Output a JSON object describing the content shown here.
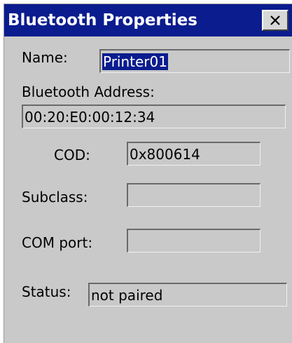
{
  "window": {
    "title": "Bluetooth Properties"
  },
  "icons": {
    "close": "close-icon"
  },
  "colors": {
    "titlebar": "#0b1c8e",
    "dialog_background": "#c9c9c9",
    "selection": "#0b1c8e"
  },
  "fields": {
    "name": {
      "label": "Name:",
      "value": "Printer01"
    },
    "address": {
      "label": "Bluetooth Address:",
      "value": "00:20:E0:00:12:34"
    },
    "cod": {
      "label": "COD:",
      "value": "0x800614"
    },
    "subclass": {
      "label": "Subclass:",
      "value": ""
    },
    "com_port": {
      "label": "COM port:",
      "value": ""
    },
    "status": {
      "label": "Status:",
      "value": "not paired"
    }
  }
}
